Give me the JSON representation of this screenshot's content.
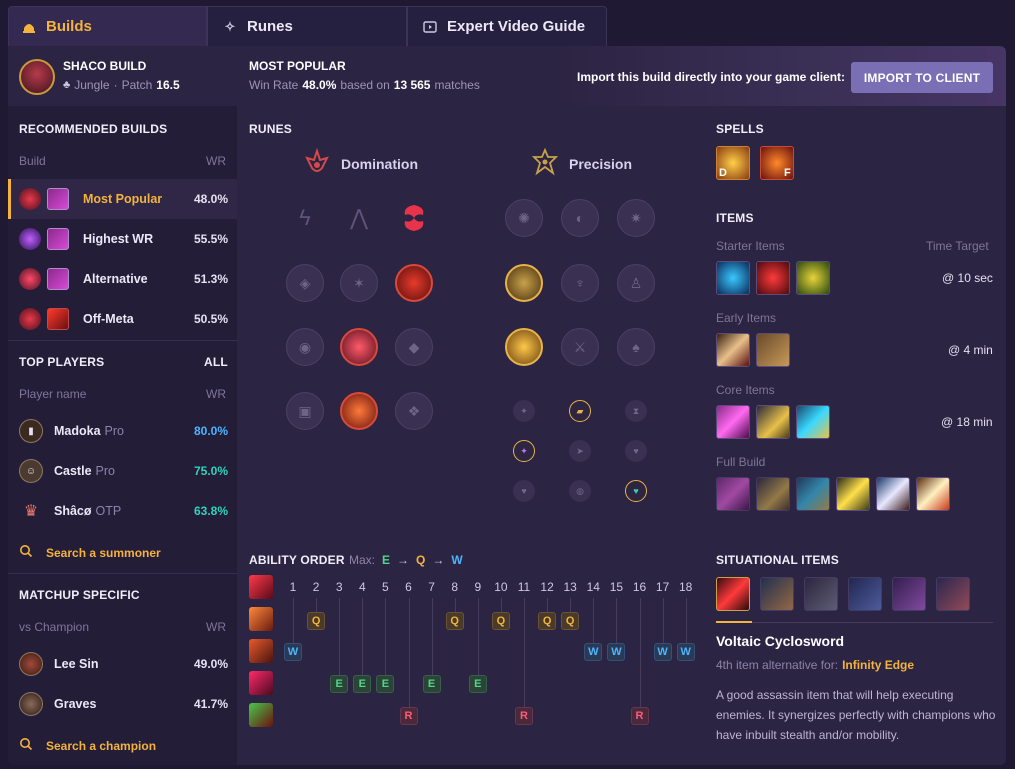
{
  "tabs": [
    {
      "label": "Builds",
      "icon": "helmet-icon"
    },
    {
      "label": "Runes",
      "icon": "sparkle-icon"
    },
    {
      "label": "Expert Video Guide",
      "icon": "video-icon"
    }
  ],
  "header": {
    "champion_build": "SHACO BUILD",
    "role": "Jungle",
    "patch_label": "Patch",
    "patch": "16.5",
    "popular_title": "MOST POPULAR",
    "winrate_prefix": "Win Rate",
    "winrate": "48.0%",
    "based_on": "based on",
    "matches": "13 565",
    "matches_suffix": "matches",
    "import_text": "Import this build directly into your game client:",
    "import_button": "IMPORT TO CLIENT"
  },
  "recommended": {
    "title": "RECOMMENDED BUILDS",
    "col_build": "Build",
    "col_wr": "WR",
    "rows": [
      {
        "name": "Most Popular",
        "wr": "48.0%",
        "selected": true
      },
      {
        "name": "Highest WR",
        "wr": "55.5%"
      },
      {
        "name": "Alternative",
        "wr": "51.3%"
      },
      {
        "name": "Off-Meta",
        "wr": "50.5%"
      }
    ]
  },
  "top_players": {
    "title": "TOP PLAYERS",
    "all": "ALL",
    "col_name": "Player name",
    "col_wr": "WR",
    "rows": [
      {
        "name": "Madoka",
        "tag": "Pro",
        "wr": "80.0%",
        "color": "#4db4ff"
      },
      {
        "name": "Castle",
        "tag": "Pro",
        "wr": "75.0%",
        "color": "#2fd3b9"
      },
      {
        "name": "Shâcø",
        "tag": "OTP",
        "wr": "63.8%",
        "color": "#2fd3b9"
      }
    ],
    "search": "Search a summoner"
  },
  "matchup": {
    "title": "MATCHUP SPECIFIC",
    "col_name": "vs Champion",
    "col_wr": "WR",
    "rows": [
      {
        "name": "Lee Sin",
        "wr": "49.0%"
      },
      {
        "name": "Graves",
        "wr": "41.7%"
      }
    ],
    "search": "Search a champion"
  },
  "runes": {
    "title": "RUNES",
    "primary": "Domination",
    "secondary": "Precision"
  },
  "ability_order": {
    "title": "ABILITY ORDER",
    "max_label": "Max:",
    "max": [
      "E",
      "Q",
      "W"
    ],
    "levels": [
      "1",
      "2",
      "3",
      "4",
      "5",
      "6",
      "7",
      "8",
      "9",
      "10",
      "11",
      "12",
      "13",
      "14",
      "15",
      "16",
      "17",
      "18"
    ],
    "q_levels": [
      2,
      8,
      10,
      12,
      13
    ],
    "w_levels": [
      1,
      14,
      15,
      17,
      18
    ],
    "e_levels": [
      3,
      4,
      5,
      7,
      9
    ],
    "r_levels": [
      6,
      11,
      16
    ],
    "labels": {
      "q": "Q",
      "w": "W",
      "e": "E",
      "r": "R"
    }
  },
  "spells": {
    "title": "SPELLS",
    "keys": [
      "D",
      "F"
    ]
  },
  "items": {
    "title": "ITEMS",
    "starter": "Starter Items",
    "time_target": "Time Target",
    "starter_time": "@ 10 sec",
    "early": "Early Items",
    "early_time": "@ 4 min",
    "core": "Core Items",
    "core_time": "@ 18 min",
    "full": "Full Build"
  },
  "situational": {
    "title": "SITUATIONAL ITEMS",
    "item_name": "Voltaic Cyclosword",
    "alt_prefix": "4th item alternative for:",
    "alt_item": "Infinity Edge",
    "description": "A good assassin item that will help executing enemies. It synergizes perfectly with champions who have inbuilt stealth and/or mobility."
  },
  "colors": {
    "accent": "#f3b33c",
    "button": "#7a6eb4",
    "q": "#f3b33c",
    "w": "#4db4ff",
    "e": "#52d48a",
    "r": "#ff5a7a"
  }
}
